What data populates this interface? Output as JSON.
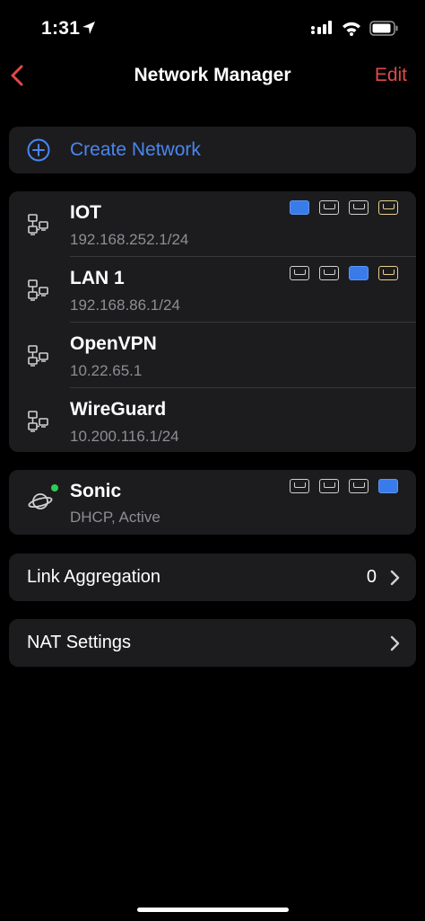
{
  "status_bar": {
    "time": "1:31"
  },
  "nav": {
    "title": "Network Manager",
    "edit_label": "Edit"
  },
  "create": {
    "label": "Create Network"
  },
  "networks": [
    {
      "name": "IOT",
      "subnet": "192.168.252.1/24",
      "ports": [
        "on",
        "off",
        "off",
        "poe"
      ]
    },
    {
      "name": "LAN 1",
      "subnet": "192.168.86.1/24",
      "ports": [
        "off",
        "off",
        "on",
        "poe"
      ]
    },
    {
      "name": "OpenVPN",
      "subnet": "10.22.65.1",
      "ports": []
    },
    {
      "name": "WireGuard",
      "subnet": "10.200.116.1/24",
      "ports": []
    }
  ],
  "wan": {
    "name": "Sonic",
    "status": "DHCP, Active",
    "status_color": "#2ecc55",
    "ports": [
      "off",
      "off",
      "off",
      "on"
    ]
  },
  "link_aggregation": {
    "label": "Link Aggregation",
    "count": "0"
  },
  "nat_settings": {
    "label": "NAT Settings"
  },
  "colors": {
    "accent_red": "#e04a4a",
    "accent_blue": "#4a86f0",
    "poe_yellow": "#e9d089",
    "background": "#000000",
    "card": "#1c1c1e"
  }
}
